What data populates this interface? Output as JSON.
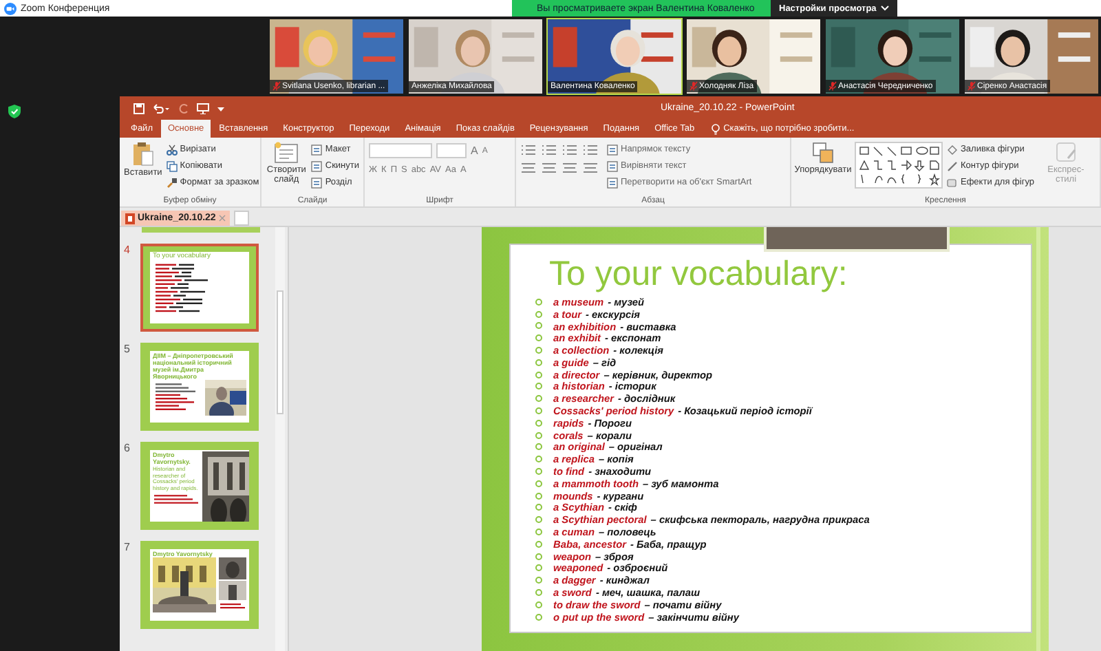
{
  "zoom": {
    "title": "Zoom Конференция",
    "banner": "Вы просматриваете экран Валентина Коваленко",
    "view_button": "Настройки просмотра"
  },
  "participants": [
    {
      "name": "Svitlana Usenko, librarian ...",
      "muted": true,
      "speaking": false
    },
    {
      "name": "Анжеліка Михайлова",
      "muted": false,
      "speaking": false
    },
    {
      "name": "Валентина Коваленко",
      "muted": false,
      "speaking": true
    },
    {
      "name": "Холодняк Ліза",
      "muted": true,
      "speaking": false
    },
    {
      "name": "Анастасія Чередниченко",
      "muted": true,
      "speaking": false
    },
    {
      "name": "Сіренко Анастасія",
      "muted": true,
      "speaking": false
    }
  ],
  "powerpoint": {
    "title": "Ukraine_20.10.22 - PowerPoint",
    "tabs": [
      {
        "label": "Файл",
        "selected": false
      },
      {
        "label": "Основне",
        "selected": true
      },
      {
        "label": "Вставлення",
        "selected": false
      },
      {
        "label": "Конструктор",
        "selected": false
      },
      {
        "label": "Переходи",
        "selected": false
      },
      {
        "label": "Анімація",
        "selected": false
      },
      {
        "label": "Показ слайдів",
        "selected": false
      },
      {
        "label": "Рецензування",
        "selected": false
      },
      {
        "label": "Подання",
        "selected": false
      },
      {
        "label": "Office Tab",
        "selected": false
      }
    ],
    "tell_me": "Скажіть, що потрібно зробити...",
    "ribbon": [
      {
        "kind": "clipboard",
        "label": "Буфер обміну",
        "big": "Вставити",
        "items": [
          "Вирізати",
          "Копіювати",
          "Формат за зразком"
        ]
      },
      {
        "kind": "slides",
        "label": "Слайди",
        "big": "Створити слайд",
        "items": [
          "Макет",
          "Скинути",
          "Розділ"
        ]
      },
      {
        "kind": "font",
        "label": "Шрифт",
        "glyphs_top": [
          "A",
          "A"
        ],
        "glyphs": [
          "Ж",
          "К",
          "П",
          "S",
          "abc",
          "AV",
          "Aa",
          "A"
        ]
      },
      {
        "kind": "paragraph",
        "label": "Абзац",
        "items": [
          "Напрямок тексту",
          "Вирівняти текст",
          "Перетворити на об'єкт SmartArt"
        ]
      },
      {
        "kind": "drawing",
        "label": "Креслення",
        "big": "Упорядкувати",
        "big2": "Експрес-стилі",
        "items": [
          "Заливка фігури",
          "Контур фігури",
          "Ефекти для фігур"
        ]
      }
    ],
    "document_tab": "Ukraine_20.10.22",
    "thumbnails": [
      {
        "number": "4",
        "selected": true,
        "kind": "vocab",
        "title": "To your vocabulary"
      },
      {
        "number": "5",
        "selected": false,
        "kind": "photo-right",
        "title": "ДІІМ – Дніпропетровський національний історичний музей ім.Дмитра Яворницького"
      },
      {
        "number": "6",
        "selected": false,
        "kind": "text-photo",
        "title": "Dmytro Yavornytsky.",
        "body": "Historian and researcher of Cossacks' period history and rapids."
      },
      {
        "number": "7",
        "selected": false,
        "kind": "gallery",
        "title": "Dmytro Yavornytsky"
      }
    ],
    "slide": {
      "title": "To your vocabulary:",
      "items": [
        {
          "term": "a museum",
          "translation": "- музей"
        },
        {
          "term": "a tour",
          "translation": "- екскурсія"
        },
        {
          "term": "an exhibition",
          "translation": "- виставка"
        },
        {
          "term": "an exhibit",
          "translation": "- експонат"
        },
        {
          "term": "a collection",
          "translation": "- колекція"
        },
        {
          "term": "a guide",
          "translation": "– гід"
        },
        {
          "term": "a director",
          "translation": "– керівник, директор"
        },
        {
          "term": "a historian",
          "translation": "- історик"
        },
        {
          "term": "a researcher",
          "translation": "- дослідник"
        },
        {
          "term": "Cossacks' period history",
          "translation": "- Козацький період історії"
        },
        {
          "term": "rapids",
          "translation": "- Пороги"
        },
        {
          "term": "corals",
          "translation": "– корали"
        },
        {
          "term": "an original",
          "translation": "– оригінал"
        },
        {
          "term": "a replica",
          "translation": "– копія"
        },
        {
          "term": "to find",
          "translation": "- знаходити"
        },
        {
          "term": "a mammoth tooth",
          "translation": "– зуб мамонта"
        },
        {
          "term": "mounds",
          "translation": "- кургани"
        },
        {
          "term": "a Scythian",
          "translation": "- скіф"
        },
        {
          "term": "a Scythian pectoral",
          "translation": "– скифська пектораль, нагрудна прикраса"
        },
        {
          "term": "a cuman",
          "translation": "– половець"
        },
        {
          "term": "Baba, ancestor",
          "translation": "- Баба, пращур"
        },
        {
          "term": "weapon",
          "translation": "– зброя"
        },
        {
          "term": "weaponed",
          "translation": "- озброєний"
        },
        {
          "term": "a dagger",
          "translation": "- кинджал"
        },
        {
          "term": "a sword",
          "translation": "- меч, шашка, палаш"
        },
        {
          "term": "to draw the sword",
          "translation": "– почати війну"
        },
        {
          "term": "o put up the sword",
          "translation": "– закінчити війну"
        }
      ]
    }
  }
}
